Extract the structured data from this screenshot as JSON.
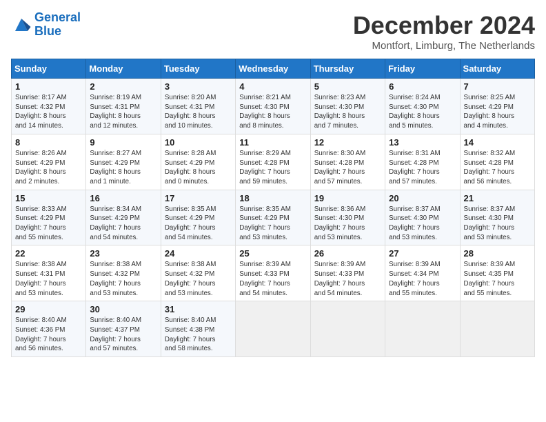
{
  "logo": {
    "line1": "General",
    "line2": "Blue"
  },
  "header": {
    "month": "December 2024",
    "location": "Montfort, Limburg, The Netherlands"
  },
  "weekdays": [
    "Sunday",
    "Monday",
    "Tuesday",
    "Wednesday",
    "Thursday",
    "Friday",
    "Saturday"
  ],
  "weeks": [
    [
      {
        "day": "1",
        "info": "Sunrise: 8:17 AM\nSunset: 4:32 PM\nDaylight: 8 hours\nand 14 minutes."
      },
      {
        "day": "2",
        "info": "Sunrise: 8:19 AM\nSunset: 4:31 PM\nDaylight: 8 hours\nand 12 minutes."
      },
      {
        "day": "3",
        "info": "Sunrise: 8:20 AM\nSunset: 4:31 PM\nDaylight: 8 hours\nand 10 minutes."
      },
      {
        "day": "4",
        "info": "Sunrise: 8:21 AM\nSunset: 4:30 PM\nDaylight: 8 hours\nand 8 minutes."
      },
      {
        "day": "5",
        "info": "Sunrise: 8:23 AM\nSunset: 4:30 PM\nDaylight: 8 hours\nand 7 minutes."
      },
      {
        "day": "6",
        "info": "Sunrise: 8:24 AM\nSunset: 4:30 PM\nDaylight: 8 hours\nand 5 minutes."
      },
      {
        "day": "7",
        "info": "Sunrise: 8:25 AM\nSunset: 4:29 PM\nDaylight: 8 hours\nand 4 minutes."
      }
    ],
    [
      {
        "day": "8",
        "info": "Sunrise: 8:26 AM\nSunset: 4:29 PM\nDaylight: 8 hours\nand 2 minutes."
      },
      {
        "day": "9",
        "info": "Sunrise: 8:27 AM\nSunset: 4:29 PM\nDaylight: 8 hours\nand 1 minute."
      },
      {
        "day": "10",
        "info": "Sunrise: 8:28 AM\nSunset: 4:29 PM\nDaylight: 8 hours\nand 0 minutes."
      },
      {
        "day": "11",
        "info": "Sunrise: 8:29 AM\nSunset: 4:28 PM\nDaylight: 7 hours\nand 59 minutes."
      },
      {
        "day": "12",
        "info": "Sunrise: 8:30 AM\nSunset: 4:28 PM\nDaylight: 7 hours\nand 57 minutes."
      },
      {
        "day": "13",
        "info": "Sunrise: 8:31 AM\nSunset: 4:28 PM\nDaylight: 7 hours\nand 57 minutes."
      },
      {
        "day": "14",
        "info": "Sunrise: 8:32 AM\nSunset: 4:28 PM\nDaylight: 7 hours\nand 56 minutes."
      }
    ],
    [
      {
        "day": "15",
        "info": "Sunrise: 8:33 AM\nSunset: 4:29 PM\nDaylight: 7 hours\nand 55 minutes."
      },
      {
        "day": "16",
        "info": "Sunrise: 8:34 AM\nSunset: 4:29 PM\nDaylight: 7 hours\nand 54 minutes."
      },
      {
        "day": "17",
        "info": "Sunrise: 8:35 AM\nSunset: 4:29 PM\nDaylight: 7 hours\nand 54 minutes."
      },
      {
        "day": "18",
        "info": "Sunrise: 8:35 AM\nSunset: 4:29 PM\nDaylight: 7 hours\nand 53 minutes."
      },
      {
        "day": "19",
        "info": "Sunrise: 8:36 AM\nSunset: 4:30 PM\nDaylight: 7 hours\nand 53 minutes."
      },
      {
        "day": "20",
        "info": "Sunrise: 8:37 AM\nSunset: 4:30 PM\nDaylight: 7 hours\nand 53 minutes."
      },
      {
        "day": "21",
        "info": "Sunrise: 8:37 AM\nSunset: 4:30 PM\nDaylight: 7 hours\nand 53 minutes."
      }
    ],
    [
      {
        "day": "22",
        "info": "Sunrise: 8:38 AM\nSunset: 4:31 PM\nDaylight: 7 hours\nand 53 minutes."
      },
      {
        "day": "23",
        "info": "Sunrise: 8:38 AM\nSunset: 4:32 PM\nDaylight: 7 hours\nand 53 minutes."
      },
      {
        "day": "24",
        "info": "Sunrise: 8:38 AM\nSunset: 4:32 PM\nDaylight: 7 hours\nand 53 minutes."
      },
      {
        "day": "25",
        "info": "Sunrise: 8:39 AM\nSunset: 4:33 PM\nDaylight: 7 hours\nand 54 minutes."
      },
      {
        "day": "26",
        "info": "Sunrise: 8:39 AM\nSunset: 4:33 PM\nDaylight: 7 hours\nand 54 minutes."
      },
      {
        "day": "27",
        "info": "Sunrise: 8:39 AM\nSunset: 4:34 PM\nDaylight: 7 hours\nand 55 minutes."
      },
      {
        "day": "28",
        "info": "Sunrise: 8:39 AM\nSunset: 4:35 PM\nDaylight: 7 hours\nand 55 minutes."
      }
    ],
    [
      {
        "day": "29",
        "info": "Sunrise: 8:40 AM\nSunset: 4:36 PM\nDaylight: 7 hours\nand 56 minutes."
      },
      {
        "day": "30",
        "info": "Sunrise: 8:40 AM\nSunset: 4:37 PM\nDaylight: 7 hours\nand 57 minutes."
      },
      {
        "day": "31",
        "info": "Sunrise: 8:40 AM\nSunset: 4:38 PM\nDaylight: 7 hours\nand 58 minutes."
      },
      {
        "day": "",
        "info": ""
      },
      {
        "day": "",
        "info": ""
      },
      {
        "day": "",
        "info": ""
      },
      {
        "day": "",
        "info": ""
      }
    ]
  ]
}
